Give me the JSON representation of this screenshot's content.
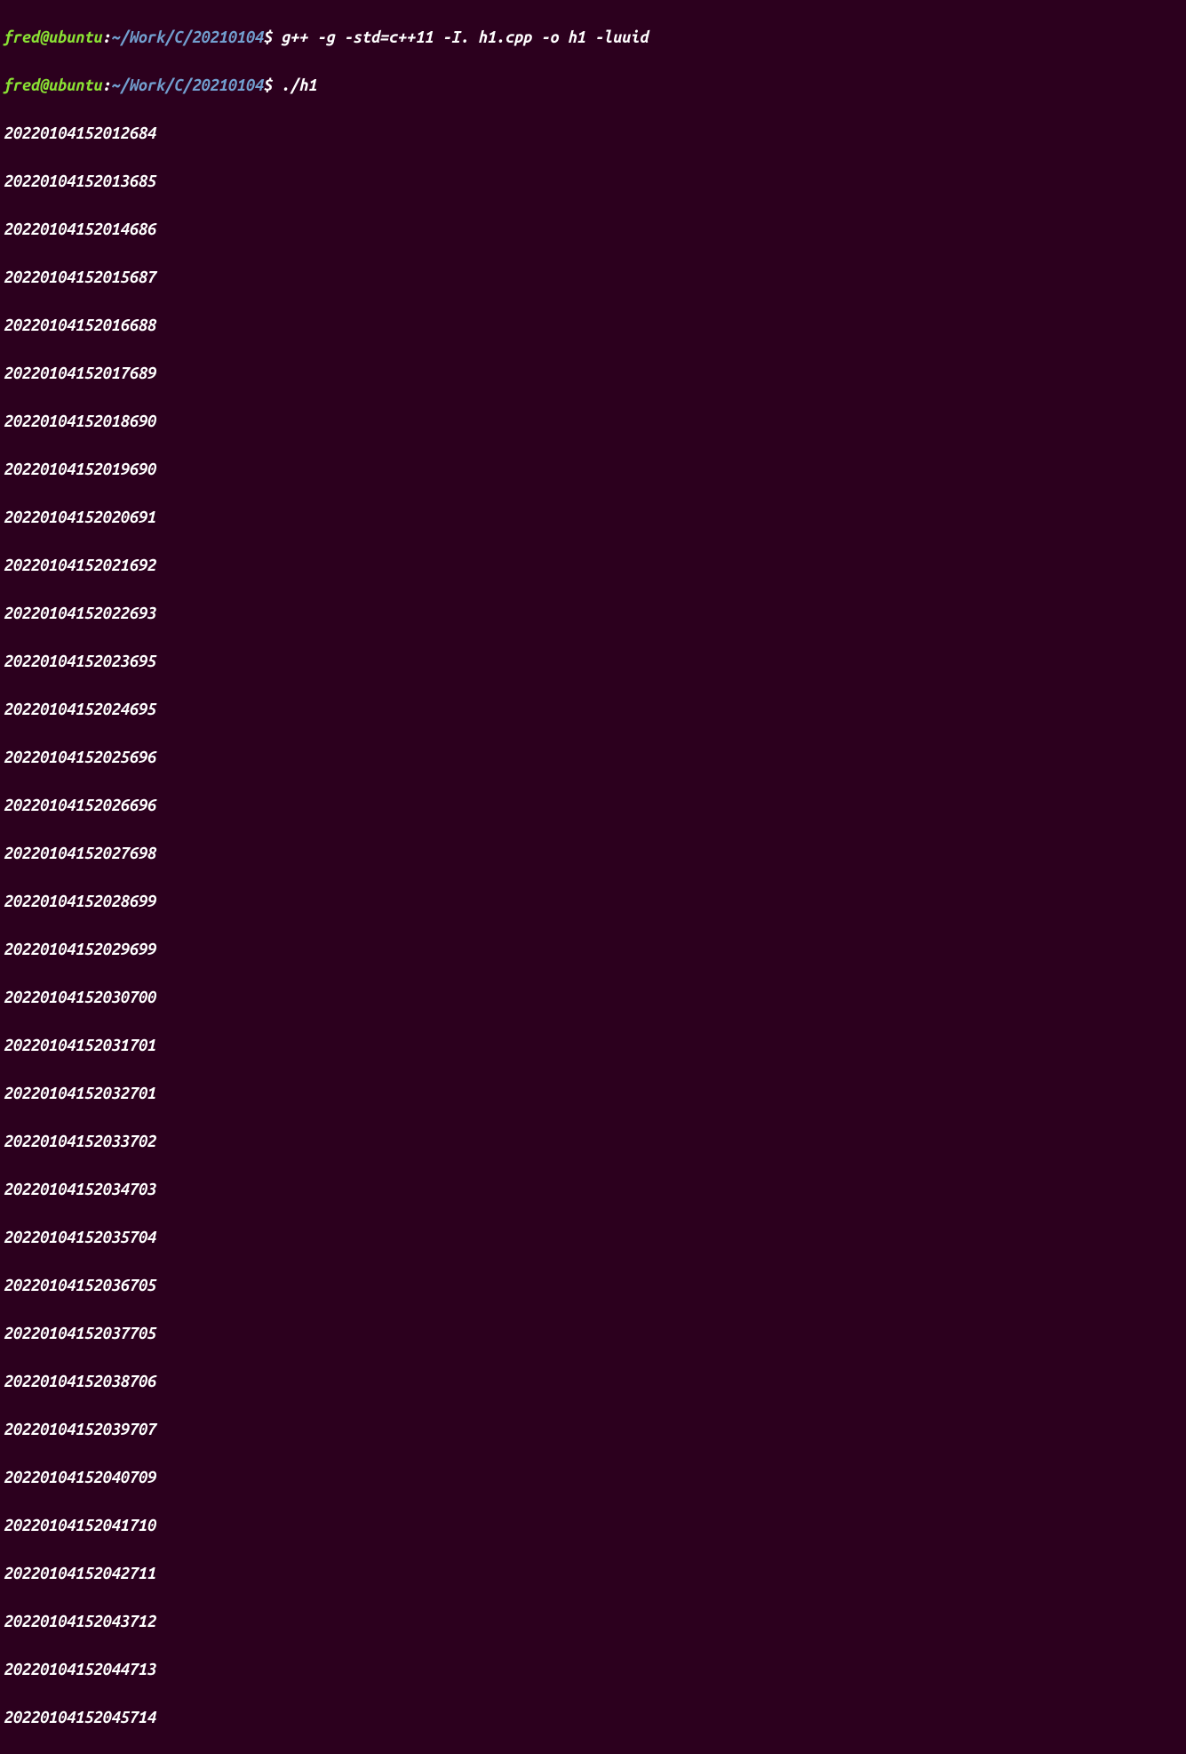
{
  "prompts": [
    {
      "user_host": "fred@ubuntu",
      "colon": ":",
      "path": "~/Work/C/20210104",
      "dollar": "$ ",
      "command": "g++ -g -std=c++11 -I. h1.cpp -o h1 -luuid"
    },
    {
      "user_host": "fred@ubuntu",
      "colon": ":",
      "path": "~/Work/C/20210104",
      "dollar": "$ ",
      "command": "./h1"
    }
  ],
  "output": [
    "20220104152012684",
    "20220104152013685",
    "20220104152014686",
    "20220104152015687",
    "20220104152016688",
    "20220104152017689",
    "20220104152018690",
    "20220104152019690",
    "20220104152020691",
    "20220104152021692",
    "20220104152022693",
    "20220104152023695",
    "20220104152024695",
    "20220104152025696",
    "20220104152026696",
    "20220104152027698",
    "20220104152028699",
    "20220104152029699",
    "20220104152030700",
    "20220104152031701",
    "20220104152032701",
    "20220104152033702",
    "20220104152034703",
    "20220104152035704",
    "20220104152036705",
    "20220104152037705",
    "20220104152038706",
    "20220104152039707",
    "20220104152040709",
    "20220104152041710",
    "20220104152042711",
    "20220104152043712",
    "20220104152044713",
    "20220104152045714"
  ]
}
